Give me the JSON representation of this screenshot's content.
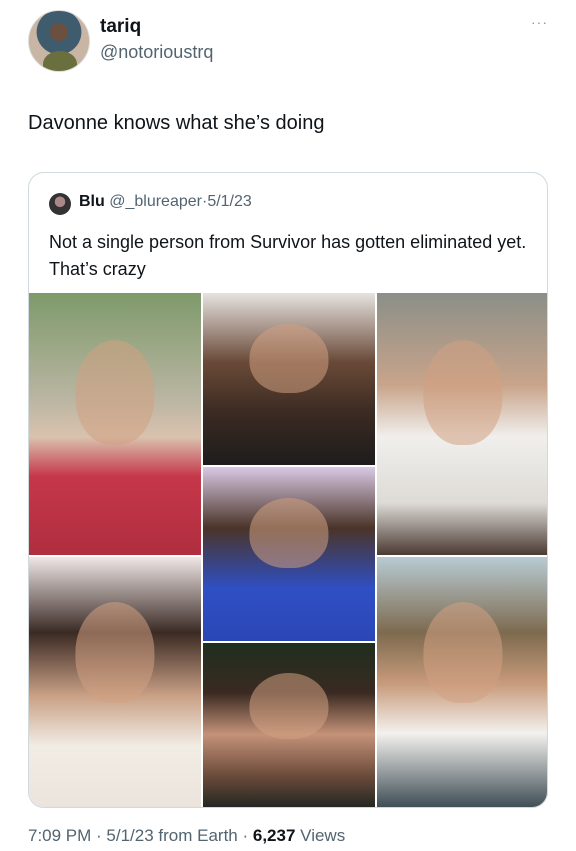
{
  "author": {
    "display_name": "tariq",
    "handle": "@notorioustrq"
  },
  "more_menu": "···",
  "tweet": {
    "text": "Davonne knows what she’s doing"
  },
  "quoted_tweet": {
    "display_name": "Blu",
    "handle": "@_blureaper",
    "separator": "·",
    "date": "5/1/23",
    "text": "Not a single person from Survivor has gotten eliminated yet. That’s crazy",
    "photos": [
      "photo-1",
      "photo-2",
      "photo-3",
      "photo-4",
      "photo-5",
      "photo-6",
      "photo-7"
    ]
  },
  "footer": {
    "time": "7:09 PM",
    "date_source": "5/1/23 from Earth",
    "views_count": "6,237",
    "views_label": "Views"
  }
}
